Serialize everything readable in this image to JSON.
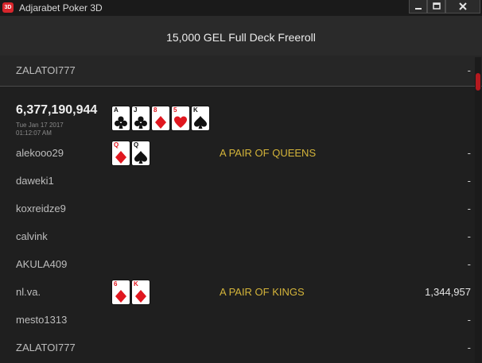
{
  "window": {
    "icon_text": "3D",
    "title": "Adjarabet Poker 3D"
  },
  "header": {
    "title": "15,000 GEL Full Deck Freeroll"
  },
  "top_row": {
    "name": "ZALATOI777",
    "value": "-"
  },
  "board": {
    "pot": "6,377,190,944",
    "date": "Tue Jan 17 2017",
    "time": "01:12:07 AM",
    "cards": [
      {
        "rank": "A",
        "suit": "clubs",
        "color": "black"
      },
      {
        "rank": "J",
        "suit": "clubs",
        "color": "black"
      },
      {
        "rank": "8",
        "suit": "diamonds",
        "color": "red"
      },
      {
        "rank": "5",
        "suit": "hearts",
        "color": "red"
      },
      {
        "rank": "K",
        "suit": "spades",
        "color": "black"
      }
    ]
  },
  "players": [
    {
      "name": "alekooo29",
      "value": "-",
      "hand": "A PAIR OF QUEENS",
      "cards": [
        {
          "rank": "Q",
          "suit": "diamonds",
          "color": "red"
        },
        {
          "rank": "Q",
          "suit": "spades",
          "color": "black"
        }
      ]
    },
    {
      "name": "daweki1",
      "value": "-"
    },
    {
      "name": "koxreidze9",
      "value": "-"
    },
    {
      "name": "calvink",
      "value": "-"
    },
    {
      "name": "AKULA409",
      "value": "-"
    },
    {
      "name": "nl.va.",
      "value": "1,344,957",
      "hand": "A PAIR OF KINGS",
      "cards": [
        {
          "rank": "6",
          "suit": "diamonds",
          "color": "red"
        },
        {
          "rank": "K",
          "suit": "diamonds",
          "color": "red"
        }
      ]
    },
    {
      "name": "mesto1313",
      "value": "-"
    },
    {
      "name": "ZALATOI777",
      "value": "-"
    }
  ],
  "colors": {
    "accent_red": "#d8262c",
    "hand_gold": "#d4b43a"
  },
  "icons": [
    "app-logo-icon",
    "minimize-icon",
    "maximize-icon",
    "close-icon"
  ]
}
